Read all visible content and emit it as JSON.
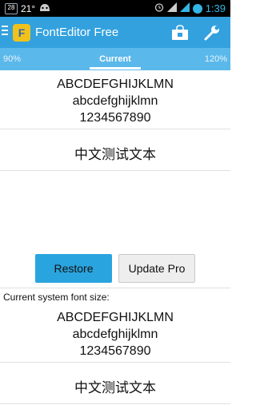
{
  "status_bar": {
    "calendar_day": "28",
    "temperature": "21°",
    "time": "1:39"
  },
  "app_bar": {
    "title": "FontEditor Free",
    "logo_text": "F"
  },
  "tabs": {
    "left": "90%",
    "center": "Current",
    "right": "120%"
  },
  "preview": {
    "line1": "ABCDEFGHIJKLMN",
    "line2": "abcdefghijklmn",
    "line3": "1234567890",
    "chinese": "中文测试文本"
  },
  "buttons": {
    "restore": "Restore",
    "update": "Update Pro"
  },
  "system_section": {
    "caption": "Current system font size:",
    "line1": "ABCDEFGHIJKLMN",
    "line2": "abcdefghijklmn",
    "line3": "1234567890",
    "chinese": "中文测试文本"
  },
  "colors": {
    "accent": "#33a1de",
    "tab_bar": "#5bb8ea",
    "restore_button": "#2aa4de"
  }
}
